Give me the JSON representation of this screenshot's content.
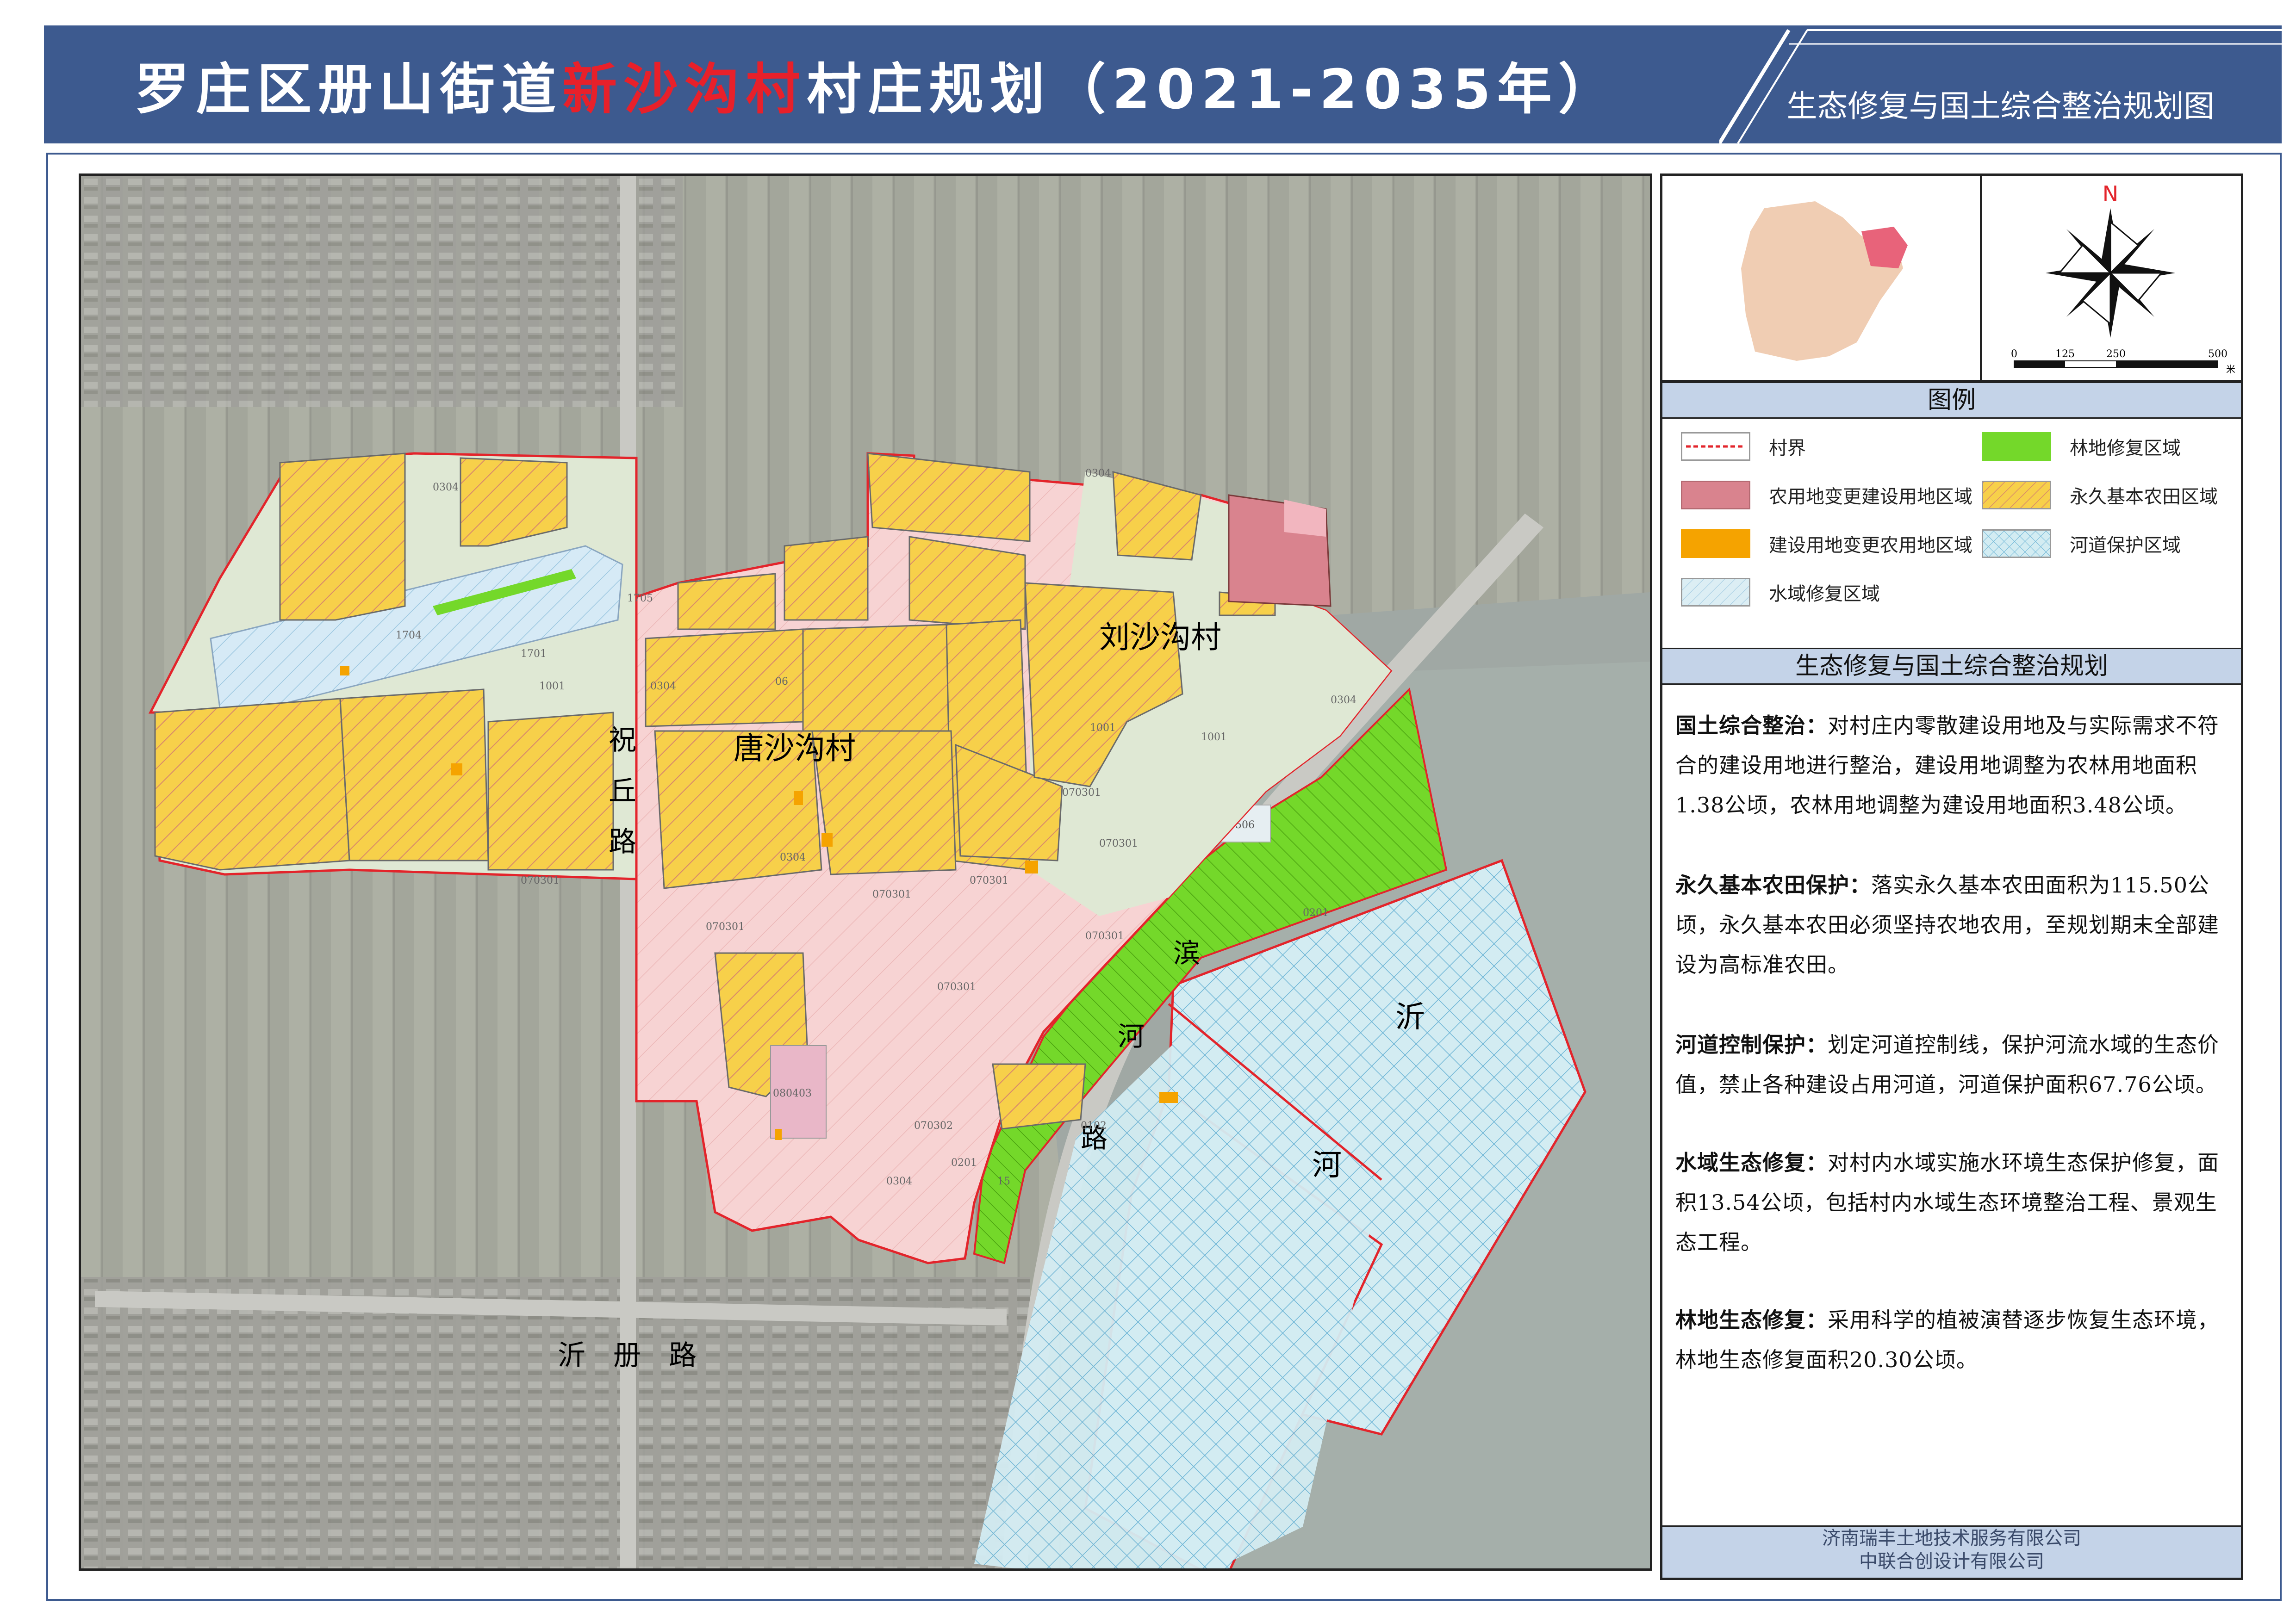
{
  "header": {
    "title_prefix": "罗庄区册山街道",
    "title_highlight": "新沙沟村",
    "title_suffix": "村庄规划（2021-2035年）",
    "subtitle": "生态修复与国土综合整治规划图",
    "highlight_color": "#e8202a",
    "bar_color": "#3d5a8f"
  },
  "map": {
    "labels": {
      "village_liu": "刘沙沟村",
      "village_tang": "唐沙沟村",
      "road_zhu_1": "祝",
      "road_zhu_2": "丘",
      "road_zhu_3": "路",
      "road_yice": "沂　册　路",
      "road_bin_1": "滨",
      "road_bin_2": "河",
      "road_bin_3": "路",
      "river_1": "沂",
      "river_2": "河"
    },
    "parcel_codes": {
      "p1": "0304",
      "p2": "1705",
      "p3": "1704",
      "p4": "1701",
      "p5": "1001",
      "p6": "0304",
      "p7": "0304",
      "p8": "1001",
      "p9": "1001",
      "p10": "070301",
      "p11": "070301",
      "p12": "070301",
      "p13": "070301",
      "p14": "070301",
      "p15": "070301",
      "p16": "070301",
      "p17": "070301",
      "p18": "070302",
      "p19": "080403",
      "p20": "0304",
      "p21": "0201",
      "p22": "15",
      "p23": "0102",
      "p24": "0506",
      "p25": "0201",
      "p26": "0304",
      "p27": "0304",
      "p28": "06"
    }
  },
  "locator": {
    "region_color": "#f0cdb3",
    "highlight_color": "#e8637a"
  },
  "compass": {
    "north": "N",
    "scale_labels": [
      "0",
      "125",
      "250",
      "500"
    ],
    "scale_unit": "米"
  },
  "legend": {
    "title": "图例",
    "items": [
      {
        "label": "村界",
        "icon": "boundary-dashed-line"
      },
      {
        "label": "林地修复区域",
        "color": "#74d82a"
      },
      {
        "label": "农用地变更建设用地区域",
        "color": "#d9838e"
      },
      {
        "label": "永久基本农田区域",
        "color": "#f7d04a"
      },
      {
        "label": "建设用地变更农用地区域",
        "color": "#f5a300"
      },
      {
        "label": "河道保护区域",
        "color": "#cfe8f0"
      },
      {
        "label": "水域修复区域",
        "color": "#dceef4"
      }
    ]
  },
  "planning": {
    "title": "生态修复与国土综合整治规划",
    "sections": [
      {
        "head": "国土综合整治：",
        "body": "对村庄内零散建设用地及与实际需求不符合的建设用地进行整治，建设用地调整为农林用地面积1.38公顷，农林用地调整为建设用地面积3.48公顷。"
      },
      {
        "head": "永久基本农田保护：",
        "body": "落实永久基本农田面积为115.50公顷，永久基本农田必须坚持农地农用，至规划期末全部建设为高标准农田。"
      },
      {
        "head": "河道控制保护：",
        "body": "划定河道控制线，保护河流水域的生态价值，禁止各种建设占用河道，河道保护面积67.76公顷。"
      },
      {
        "head": "水域生态修复：",
        "body": "对村内水域实施水环境生态保护修复，面积13.54公顷，包括村内水域生态环境整治工程、景观生态工程。"
      },
      {
        "head": "林地生态修复：",
        "body": "采用科学的植被演替逐步恢复生态环境，林地生态修复面积20.30公顷。"
      }
    ]
  },
  "footer": {
    "line1": "济南瑞丰土地技术服务有限公司",
    "line2": "中联合创设计有限公司"
  }
}
